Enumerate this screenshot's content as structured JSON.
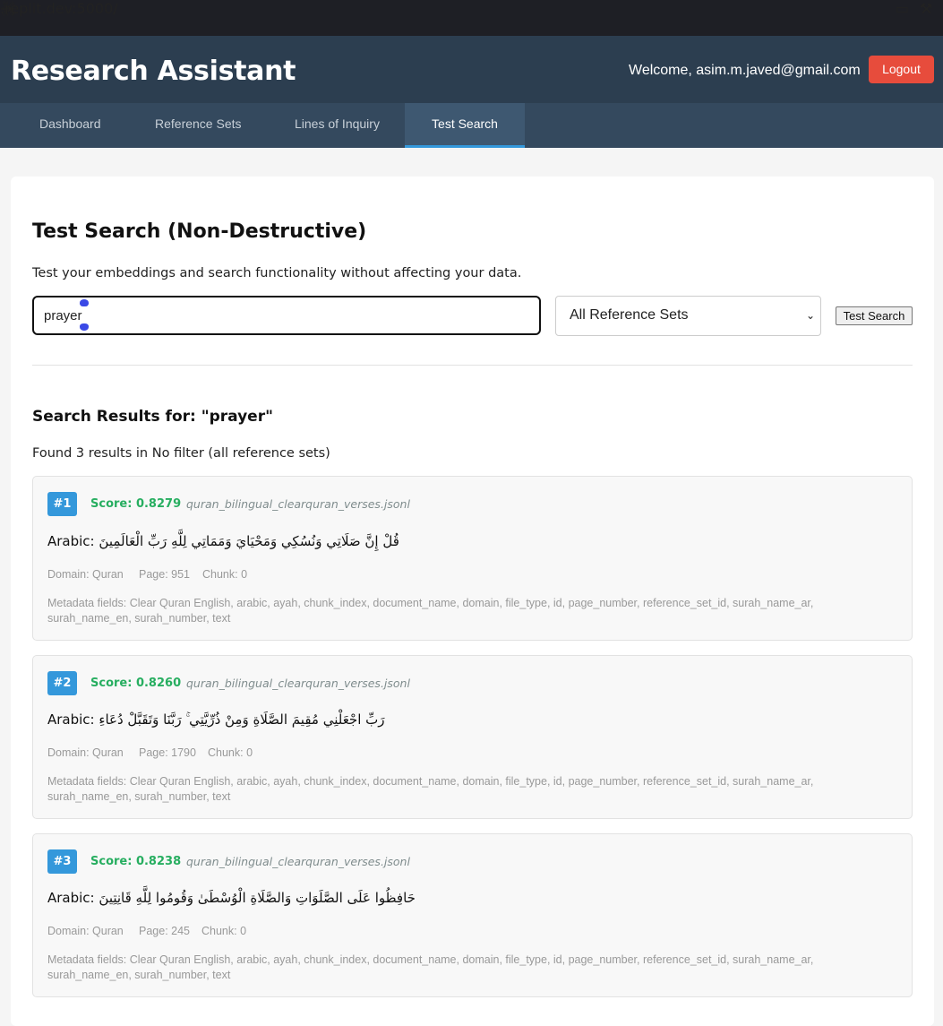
{
  "browser": {
    "url_host": ".replit.dev:5000",
    "url_path": "/"
  },
  "header": {
    "title": "Research Assistant",
    "welcome": "Welcome, asim.m.javed@gmail.com",
    "logout_label": "Logout"
  },
  "nav": {
    "tabs": [
      {
        "label": "Dashboard"
      },
      {
        "label": "Reference Sets"
      },
      {
        "label": "Lines of Inquiry"
      },
      {
        "label": "Test Search"
      }
    ],
    "active": "Test Search"
  },
  "page": {
    "title": "Test Search (Non-Destructive)",
    "description": "Test your embeddings and search functionality without affecting your data."
  },
  "search": {
    "query": "prayer",
    "filter_selected": "All Reference Sets",
    "button_label": "Test Search"
  },
  "results": {
    "title": "Search Results for: \"prayer\"",
    "summary": "Found 3 results in No filter (all reference sets)",
    "items": [
      {
        "rank": "#1",
        "score": "Score: 0.8279",
        "file": "quran_bilingual_clearquran_verses.jsonl",
        "arabic_label": "Arabic:",
        "arabic": "قُلْ إِنَّ صَلَاتِي وَنُسُكِي وَمَحْيَايَ وَمَمَاتِي لِلَّهِ رَبِّ الْعَالَمِينَ",
        "domain": "Domain: Quran",
        "page": "Page: 951",
        "chunk": "Chunk: 0",
        "metadata": "Metadata fields: Clear Quran English, arabic, ayah, chunk_index, document_name, domain, file_type, id, page_number, reference_set_id, surah_name_ar, surah_name_en, surah_number, text"
      },
      {
        "rank": "#2",
        "score": "Score: 0.8260",
        "file": "quran_bilingual_clearquran_verses.jsonl",
        "arabic_label": "Arabic:",
        "arabic": "رَبِّ اجْعَلْنِي مُقِيمَ الصَّلَاةِ وَمِنْ ذُرِّيَّتِي ۚ رَبَّنَا وَتَقَبَّلْ دُعَاءِ",
        "domain": "Domain: Quran",
        "page": "Page: 1790",
        "chunk": "Chunk: 0",
        "metadata": "Metadata fields: Clear Quran English, arabic, ayah, chunk_index, document_name, domain, file_type, id, page_number, reference_set_id, surah_name_ar, surah_name_en, surah_number, text"
      },
      {
        "rank": "#3",
        "score": "Score: 0.8238",
        "file": "quran_bilingual_clearquran_verses.jsonl",
        "arabic_label": "Arabic:",
        "arabic": "حَافِظُوا عَلَى الصَّلَوَاتِ وَالصَّلَاةِ الْوُسْطَىٰ وَقُومُوا لِلَّهِ قَانِتِينَ",
        "domain": "Domain: Quran",
        "page": "Page: 245",
        "chunk": "Chunk: 0",
        "metadata": "Metadata fields: Clear Quran English, arabic, ayah, chunk_index, document_name, domain, file_type, id, page_number, reference_set_id, surah_name_ar, surah_name_en, surah_number, text"
      }
    ]
  },
  "colors": {
    "header_bg": "#2c3e50",
    "nav_bg": "#34495e",
    "accent": "#3498db",
    "logout": "#e74c3c",
    "score": "#27ae60"
  }
}
